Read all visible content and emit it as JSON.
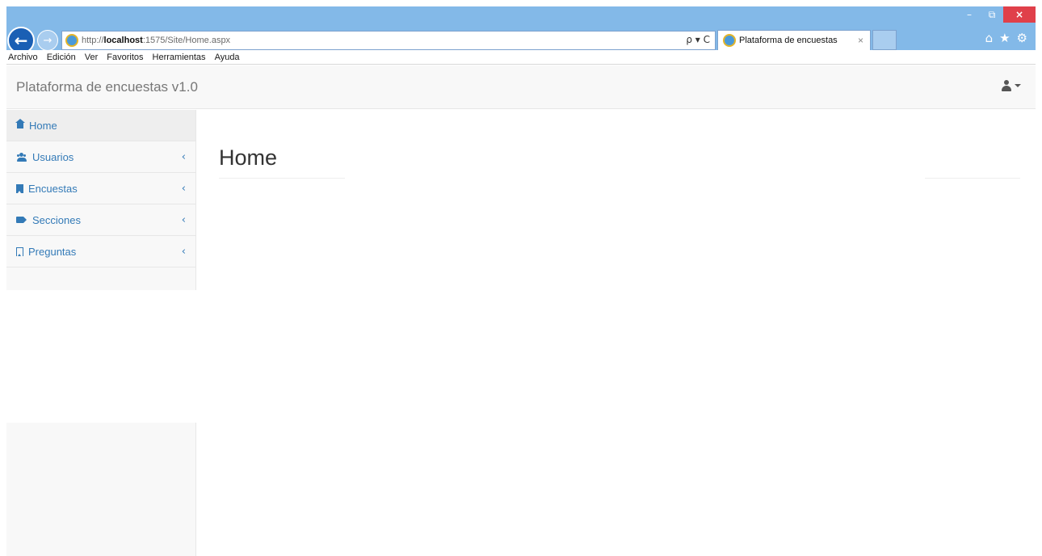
{
  "browser": {
    "url_prefix": "http://",
    "url_host": "localhost",
    "url_rest": ":1575/Site/Home.aspx",
    "tab_title": "Plataforma de encuestas",
    "tab_close": "×",
    "address_tools": "ρ ▾ C",
    "window_controls": {
      "minimize": "–",
      "restore": "⧉",
      "close": "×"
    },
    "toolbar_icons": {
      "home": "⌂",
      "favorites": "★",
      "settings": "⚙"
    },
    "back_glyph": "←",
    "forward_glyph": "→"
  },
  "menubar": {
    "items": [
      "Archivo",
      "Edición",
      "Ver",
      "Favoritos",
      "Herramientas",
      "Ayuda"
    ]
  },
  "navbar": {
    "brand": "Plataforma de encuestas v1.0"
  },
  "sidebar": {
    "items": [
      {
        "label": "Home",
        "icon": "home-icon",
        "active": true
      },
      {
        "label": "Usuarios",
        "icon": "users-icon",
        "chevron": "‹"
      },
      {
        "label": "Encuestas",
        "icon": "bookmark-icon",
        "chevron": "‹"
      },
      {
        "label": "Secciones",
        "icon": "tags-icon",
        "chevron": "‹"
      },
      {
        "label": "Preguntas",
        "icon": "bookmark-outline-icon",
        "chevron": "‹"
      }
    ]
  },
  "main": {
    "title": "Home"
  },
  "colors": {
    "titlebar": "#83b9e8",
    "link": "#337ab7",
    "navbar_bg": "#f8f8f8",
    "close_button": "#e0404a"
  }
}
